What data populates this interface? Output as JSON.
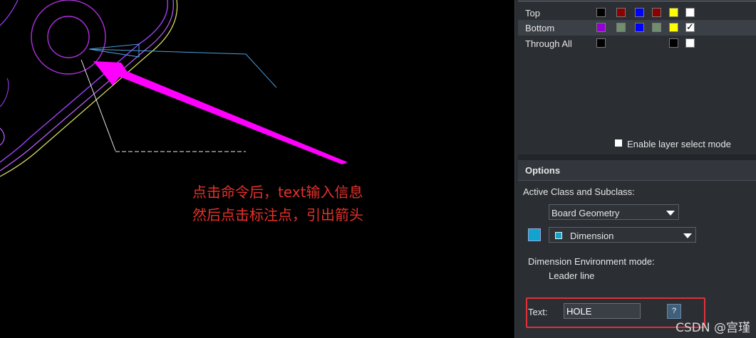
{
  "annotation": {
    "line1": "点击命令后，text输入信息",
    "line2": "然后点击标注点，引出箭头"
  },
  "layers": {
    "rows": [
      {
        "name": "Top",
        "swatches": [
          "#000000",
          "#8b0000",
          "#0000ff",
          "#8b0000",
          "#ffff00",
          "#ffffff"
        ]
      },
      {
        "name": "Bottom",
        "swatches": [
          "#9400d3",
          "#6f8f6f",
          "#0000ff",
          "#6f8f6f",
          "#ffff00",
          "#ffffff"
        ],
        "checked": "✓"
      },
      {
        "name": "Through All",
        "swatches": [
          "#000000",
          "",
          "",
          "",
          "#000000",
          "#ffffff"
        ]
      }
    ],
    "enable_label": "Enable layer select mode"
  },
  "options": {
    "title": "Options",
    "active_class_label": "Active Class and Subclass:",
    "class_value": "Board Geometry",
    "subclass_value": "Dimension",
    "subclass_color": "#12a4cf",
    "dim_env_label": "Dimension Environment mode:",
    "dim_env_value": "Leader line",
    "text_label": "Text:",
    "text_value": "HOLE",
    "help_label": "?"
  },
  "watermark": "CSDN @宫瑾",
  "colors": {
    "annotation_text": "#e8312a",
    "arrow": "#ff00ff",
    "highlight": "#e0303a",
    "panel_bg": "#2b2e33"
  }
}
